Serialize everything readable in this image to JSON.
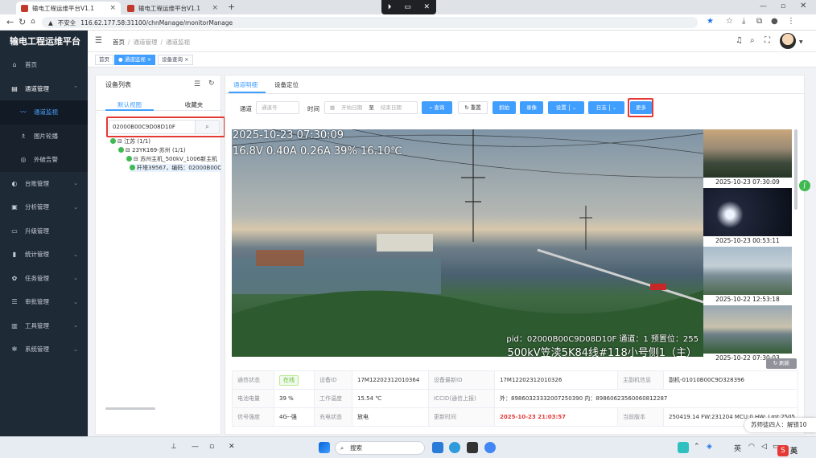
{
  "browser": {
    "tabs": [
      {
        "title": "输电工程运维平台V1.1",
        "close": "×"
      },
      {
        "title": "输电工程运维平台V1.1",
        "close": "×"
      }
    ],
    "new_tab": "+",
    "not_secure": "不安全",
    "url": "116.62.177.58:31100/chnManage/monitorManage",
    "screen_controls": [
      "⏵",
      "▭",
      "✕"
    ]
  },
  "app": {
    "title": "输电工程运维平台",
    "menu": [
      {
        "label": "首页",
        "icon": "home-icon"
      },
      {
        "label": "通道管理",
        "icon": "document-icon"
      },
      {
        "label": "通道监视",
        "icon": "monitor-icon"
      },
      {
        "label": "图片轮播",
        "icon": "image-icon"
      },
      {
        "label": "外破告警",
        "icon": "alarm-icon"
      },
      {
        "label": "台账管理",
        "icon": "ledger-icon"
      },
      {
        "label": "分析管理",
        "icon": "analysis-icon"
      },
      {
        "label": "升级管理",
        "icon": "upgrade-icon"
      },
      {
        "label": "统计管理",
        "icon": "stats-icon"
      },
      {
        "label": "任务管理",
        "icon": "task-icon"
      },
      {
        "label": "审批管理",
        "icon": "approval-icon"
      },
      {
        "label": "工具管理",
        "icon": "tool-icon"
      },
      {
        "label": "系统管理",
        "icon": "system-icon"
      }
    ]
  },
  "header": {
    "breadcrumb": [
      "首页",
      "通道管理",
      "通道监视"
    ]
  },
  "tags": [
    {
      "label": "首页"
    },
    {
      "label": "● 通道监视 ×"
    },
    {
      "label": "设备查询 ×"
    }
  ],
  "device_panel": {
    "title": "设备列表",
    "tabs": [
      "默认视图",
      "收藏夹"
    ],
    "search_value": "02000B00C9D08D10F",
    "tree": [
      "⊟ 江苏 (1/1)",
      "⊟ 23YK169-苏州 (1/1)",
      "⊟ 苏州主机_500kV_1006新主机",
      "杆塔39567，编码：02000B00C9D08D10F"
    ]
  },
  "main": {
    "tabs": [
      "通道明细",
      "设备定位"
    ],
    "filter": {
      "channel_label": "通道",
      "channel_placeholder": "通道号",
      "time_label": "时间",
      "start_placeholder": "开始日期",
      "range_sep": "至",
      "end_placeholder": "结束日期"
    },
    "buttons": {
      "query": "查询",
      "reset": "重置",
      "capture": "抓拍",
      "record": "录像",
      "settings": "设置",
      "log": "日志",
      "more": "更多",
      "refresh": "刷新"
    },
    "camera": {
      "timestamp": "2025-10-23 07:30:09",
      "telemetry": "16.8V 0.40A 0.26A 39% 16.10℃",
      "pid_line": "pid：02000B00C9D08D10F 通道：1 预置位：255",
      "name_line": "500kV笠渎5K84线#118小号侧1（主）"
    },
    "thumbnails": [
      {
        "time": "2025-10-23 07:30:09"
      },
      {
        "time": "2025-10-23 00:53:11"
      },
      {
        "time": "2025-10-22 12:53:18"
      },
      {
        "time": "2025-10-22 07:30:03"
      }
    ],
    "info": [
      [
        "通信状态",
        "在线",
        "设备ID",
        "17M12202312010364",
        "设备最新ID",
        "17M12202312010326",
        "主副机信息",
        "副机-01010B00C9D328396"
      ],
      [
        "电池电量",
        "39 %",
        "工作温度",
        "15.54 ℃",
        "ICCID(通信上报)",
        "外：89860323332007250390 内：89860623560060812287",
        "",
        ""
      ],
      [
        "信号强度",
        "4G--强",
        "充电状态",
        "放电",
        "更新时间",
        "2025-10-23 21:03:57",
        "当前版本",
        "250419.14 FW:231204 MCU:0 HW: Lmt:2505"
      ]
    ]
  },
  "overlays": {
    "notify": "苏师徒四人：解锁10"
  },
  "taskbar": {
    "search": "搜索",
    "ime": "英",
    "ime2": "英"
  }
}
